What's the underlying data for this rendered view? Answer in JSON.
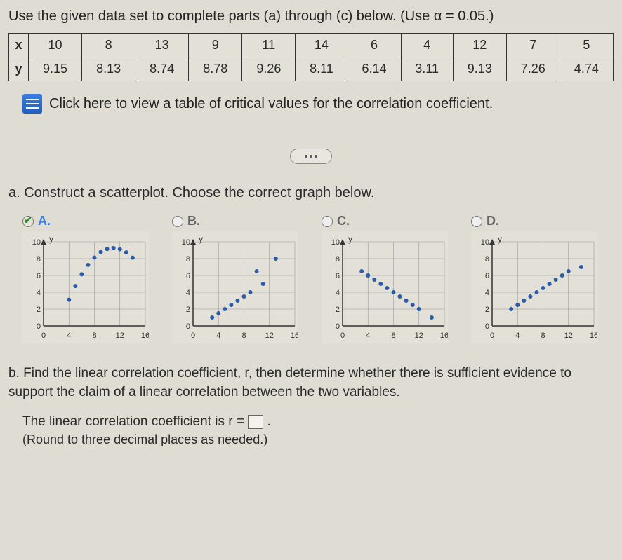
{
  "heading": "Use the given data set to complete parts (a) through (c) below. (Use α = 0.05.)",
  "table": {
    "row_x_label": "x",
    "row_y_label": "y",
    "x": [
      "10",
      "8",
      "13",
      "9",
      "11",
      "14",
      "6",
      "4",
      "12",
      "7",
      "5"
    ],
    "y": [
      "9.15",
      "8.13",
      "8.74",
      "8.78",
      "9.26",
      "8.11",
      "6.14",
      "3.11",
      "9.13",
      "7.26",
      "4.74"
    ]
  },
  "link_text": "Click here to view a table of critical values for the correlation coefficient.",
  "part_a_text": "a. Construct a scatterplot. Choose the correct graph below.",
  "options": {
    "A": {
      "letter": "A.",
      "selected": true
    },
    "B": {
      "letter": "B.",
      "selected": false
    },
    "C": {
      "letter": "C.",
      "selected": false
    },
    "D": {
      "letter": "D.",
      "selected": false
    }
  },
  "axis": {
    "ylabel": "y"
  },
  "chart_data": [
    {
      "type": "scatter",
      "label": "A",
      "xlim": [
        0,
        16
      ],
      "ylim": [
        0,
        10
      ],
      "xticks": [
        "0",
        "4",
        "8",
        "12",
        "16"
      ],
      "yticks": [
        "0",
        "2",
        "4",
        "6",
        "8",
        "10"
      ],
      "points": [
        [
          10,
          9.15
        ],
        [
          8,
          8.13
        ],
        [
          13,
          8.74
        ],
        [
          9,
          8.78
        ],
        [
          11,
          9.26
        ],
        [
          14,
          8.11
        ],
        [
          6,
          6.14
        ],
        [
          4,
          3.11
        ],
        [
          12,
          9.13
        ],
        [
          7,
          7.26
        ],
        [
          5,
          4.74
        ]
      ]
    },
    {
      "type": "scatter",
      "label": "B",
      "xlim": [
        0,
        16
      ],
      "ylim": [
        0,
        10
      ],
      "xticks": [
        "0",
        "4",
        "8",
        "12",
        "16"
      ],
      "yticks": [
        "0",
        "2",
        "4",
        "6",
        "8",
        "10"
      ],
      "points": [
        [
          3,
          1
        ],
        [
          4,
          1.5
        ],
        [
          5,
          2
        ],
        [
          6,
          2.5
        ],
        [
          7,
          3
        ],
        [
          8,
          3.5
        ],
        [
          9,
          4
        ],
        [
          10,
          6.5
        ],
        [
          11,
          5
        ],
        [
          13,
          8
        ]
      ]
    },
    {
      "type": "scatter",
      "label": "C",
      "xlim": [
        0,
        16
      ],
      "ylim": [
        0,
        10
      ],
      "xticks": [
        "0",
        "4",
        "8",
        "12",
        "16"
      ],
      "yticks": [
        "0",
        "2",
        "4",
        "6",
        "8",
        "10"
      ],
      "points": [
        [
          3,
          6.5
        ],
        [
          4,
          6
        ],
        [
          5,
          5.5
        ],
        [
          6,
          5
        ],
        [
          7,
          4.5
        ],
        [
          8,
          4
        ],
        [
          9,
          3.5
        ],
        [
          10,
          3
        ],
        [
          11,
          2.5
        ],
        [
          12,
          2
        ],
        [
          14,
          1
        ]
      ]
    },
    {
      "type": "scatter",
      "label": "D",
      "xlim": [
        0,
        16
      ],
      "ylim": [
        0,
        10
      ],
      "xticks": [
        "0",
        "4",
        "8",
        "12",
        "16"
      ],
      "yticks": [
        "0",
        "2",
        "4",
        "6",
        "8",
        "10"
      ],
      "points": [
        [
          3,
          2
        ],
        [
          4,
          2.5
        ],
        [
          5,
          3
        ],
        [
          6,
          3.5
        ],
        [
          7,
          4
        ],
        [
          8,
          4.5
        ],
        [
          9,
          5
        ],
        [
          10,
          5.5
        ],
        [
          11,
          6
        ],
        [
          12,
          6.5
        ],
        [
          14,
          7
        ]
      ]
    }
  ],
  "part_b_text": "b. Find the linear correlation coefficient, r, then determine whether there is sufficient evidence to support the claim of a linear correlation between the two variables.",
  "answer_prefix": "The linear correlation coefficient is r = ",
  "answer_suffix": ".",
  "round_note": "(Round to three decimal places as needed.)"
}
